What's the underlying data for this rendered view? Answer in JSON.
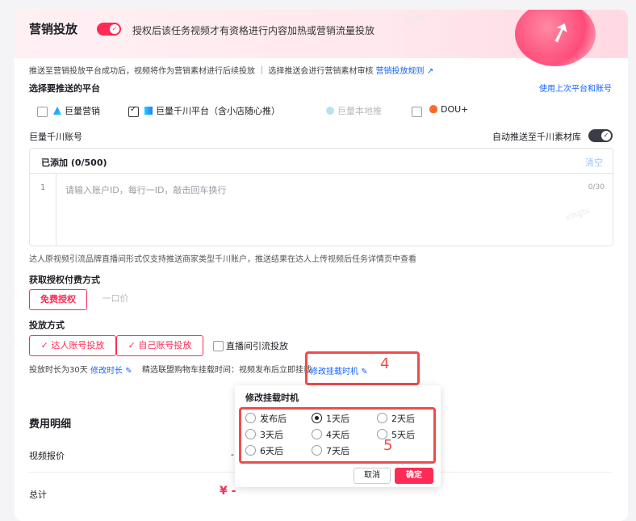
{
  "header": {
    "title": "营销投放",
    "description": "授权后该任务视频才有资格进行内容加热或营销流量投放"
  },
  "intro": {
    "text": "推送至营销投放平台成功后，视频将作为营销素材进行后续投放 ｜ 选择推送会进行营销素材审核",
    "rules_link": "营销投放规则"
  },
  "platforms": {
    "section_label": "选择要推送的平台",
    "use_last": "使用上次平台和账号",
    "items": [
      {
        "label": "巨量营销",
        "checked": false,
        "disabled": false
      },
      {
        "label": "巨量千川平台（含小店随心推）",
        "checked": true,
        "disabled": false
      },
      {
        "label": "巨量本地推",
        "checked": false,
        "disabled": true
      },
      {
        "label": "DOU+",
        "checked": false,
        "disabled": false
      }
    ]
  },
  "account": {
    "section_label": "巨量千川账号",
    "auto_push_label": "自动推送至千川素材库",
    "added_label": "已添加 (0/500)",
    "clear_label": "清空",
    "line_number": "1",
    "placeholder": "请输入账户ID，每行一ID，敲击回车换行",
    "counter": "0/30",
    "tip": "达人原视频引流品牌直播间形式仅支持推送商家类型千川账户，推送结果在达人上传视频后任务详情页中查看"
  },
  "payment": {
    "section_label": "获取授权付费方式",
    "free": "免费授权",
    "fixed": "一口价"
  },
  "delivery": {
    "section_label": "投放方式",
    "creator_account": "达人账号投放",
    "own_account": "自己账号投放",
    "live_traffic": "直播间引流投放",
    "duration_text": "投放时长为30天",
    "modify_duration": "修改时长",
    "mount_text": "精选联盟购物车挂载时间：视频发布后立即挂载",
    "modify_mount": "修改挂载时机"
  },
  "annotations": {
    "four": "4",
    "five": "5"
  },
  "popover": {
    "title": "修改挂载时机",
    "options": [
      "发布后",
      "1天后",
      "2天后",
      "3天后",
      "4天后",
      "5天后",
      "6天后",
      "7天后"
    ],
    "selected": "1天后",
    "cancel": "取消",
    "confirm": "确定"
  },
  "fees": {
    "section_label": "费用明细",
    "video_price": "视频报价",
    "video_price_value": "-",
    "total": "总计",
    "total_value": "¥ -"
  },
  "colors": {
    "accent": "#fe2c55",
    "link": "#1664ff",
    "annotation": "#f04b4b"
  }
}
